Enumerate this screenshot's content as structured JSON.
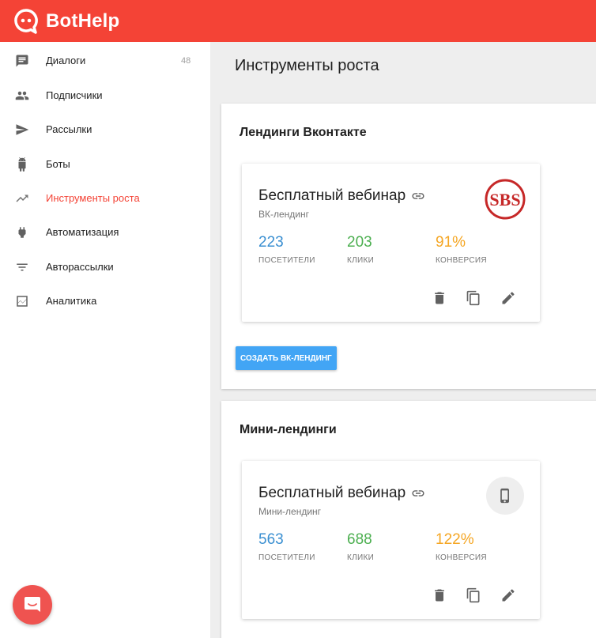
{
  "brand": {
    "name": "BotHelp",
    "color": "#f44336"
  },
  "sidebar": {
    "items": [
      {
        "label": "Диалоги",
        "icon": "chat-icon",
        "count": "48"
      },
      {
        "label": "Подписчики",
        "icon": "people-icon"
      },
      {
        "label": "Рассылки",
        "icon": "send-icon"
      },
      {
        "label": "Боты",
        "icon": "android-icon"
      },
      {
        "label": "Инструменты роста",
        "icon": "trending-up-icon",
        "active": true
      },
      {
        "label": "Автоматизация",
        "icon": "plug-icon"
      },
      {
        "label": "Авторассылки",
        "icon": "filter-icon"
      },
      {
        "label": "Аналитика",
        "icon": "chart-icon"
      }
    ]
  },
  "page": {
    "title": "Инструменты роста"
  },
  "sections": [
    {
      "title": "Лендинги Вконтакте",
      "card": {
        "title": "Бесплатный вебинар",
        "subtitle": "ВК-лендинг",
        "logo": "SBS",
        "stats": [
          {
            "value": "223",
            "label": "ПОСЕТИТЕЛИ",
            "color": "#3a8fd1"
          },
          {
            "value": "203",
            "label": "КЛИКИ",
            "color": "#4caf50"
          },
          {
            "value": "91%",
            "label": "КОНВЕРСИЯ",
            "color": "#f5a623"
          }
        ]
      },
      "button": "СОЗДАТЬ ВК-ЛЕНДИНГ"
    },
    {
      "title": "Мини-лендинги",
      "card": {
        "title": "Бесплатный вебинар",
        "subtitle": "Мини-лендинг",
        "badge_icon": "smartphone-icon",
        "stats": [
          {
            "value": "563",
            "label": "ПОСЕТИТЕЛИ",
            "color": "#3a8fd1"
          },
          {
            "value": "688",
            "label": "КЛИКИ",
            "color": "#4caf50"
          },
          {
            "value": "122%",
            "label": "КОНВЕРСИЯ",
            "color": "#f5a623"
          }
        ]
      }
    }
  ]
}
